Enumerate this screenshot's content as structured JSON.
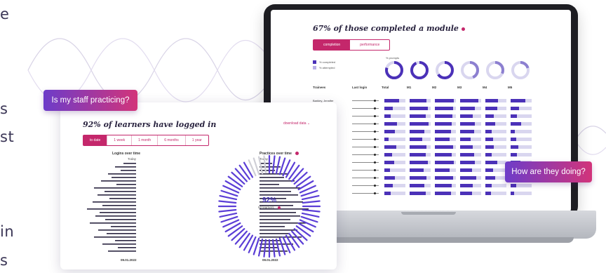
{
  "left_text": {
    "fragments": [
      "e",
      "s",
      "st",
      "in",
      "s"
    ]
  },
  "bubbles": {
    "staff": "Is my staff practicing?",
    "doing": "How are they doing?"
  },
  "laptop_screen": {
    "title": "67% of those completed a module",
    "toggle": [
      "completion",
      "performance"
    ],
    "legend": [
      "% completed",
      "% attempted"
    ],
    "donut_label": "% prompts",
    "table_headers": [
      "Trainees",
      "Last login",
      "Total",
      "M1",
      "M2",
      "M3",
      "M4",
      "M5"
    ],
    "rows": [
      {
        "name": "Barkley, Jennifer"
      },
      {
        "name": ""
      },
      {
        "name": ""
      },
      {
        "name": ", Mark"
      },
      {
        "name": ""
      },
      {
        "name": ""
      },
      {
        "name": ""
      },
      {
        "name": ""
      },
      {
        "name": ""
      },
      {
        "name": ""
      },
      {
        "name": ""
      },
      {
        "name": ""
      },
      {
        "name": ""
      }
    ]
  },
  "dashboard": {
    "title": "92% of learners have logged in",
    "download": "download data",
    "tabs": [
      "to date",
      "1 week",
      "1 month",
      "6 months",
      "1 year"
    ],
    "logins_label": "Logins over time",
    "practices_label": "Practices over time",
    "today": "Today",
    "center_value": "92%",
    "center_sub": "52 learners",
    "date_left": "09.01.2022",
    "date_right": "09.01.2022"
  },
  "colors": {
    "accent": "#c4276b",
    "purple": "#4b31b8",
    "bubble_from": "#6d3cc9",
    "bubble_to": "#d2347a"
  }
}
